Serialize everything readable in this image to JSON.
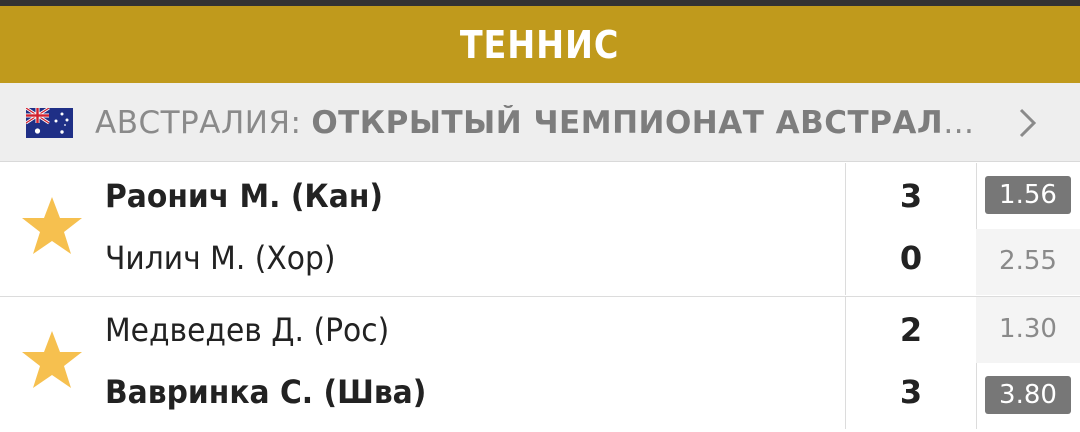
{
  "header": {
    "title": "ТЕННИС"
  },
  "league": {
    "flag_icon": "australia-flag-icon",
    "country": "АВСТРАЛИЯ:",
    "name": "ОТКРЫТЫЙ ЧЕМПИОНАТ АВСТРАЛИИ ATP, Х..."
  },
  "colors": {
    "header_bg": "#c09a1c",
    "star": "#f6c04f",
    "odd_active_bg": "#777777"
  },
  "matches": [
    {
      "favorite_icon": "star-icon",
      "team1": {
        "name": "Раонич М. (Кан)",
        "score": "3",
        "odd": "1.56",
        "winner": true
      },
      "team2": {
        "name": "Чилич М. (Хор)",
        "score": "0",
        "odd": "2.55",
        "winner": false
      }
    },
    {
      "favorite_icon": "star-icon",
      "team1": {
        "name": "Медведев Д. (Рос)",
        "score": "2",
        "odd": "1.30",
        "winner": false
      },
      "team2": {
        "name": "Вавринка С. (Шва)",
        "score": "3",
        "odd": "3.80",
        "winner": true
      }
    }
  ]
}
